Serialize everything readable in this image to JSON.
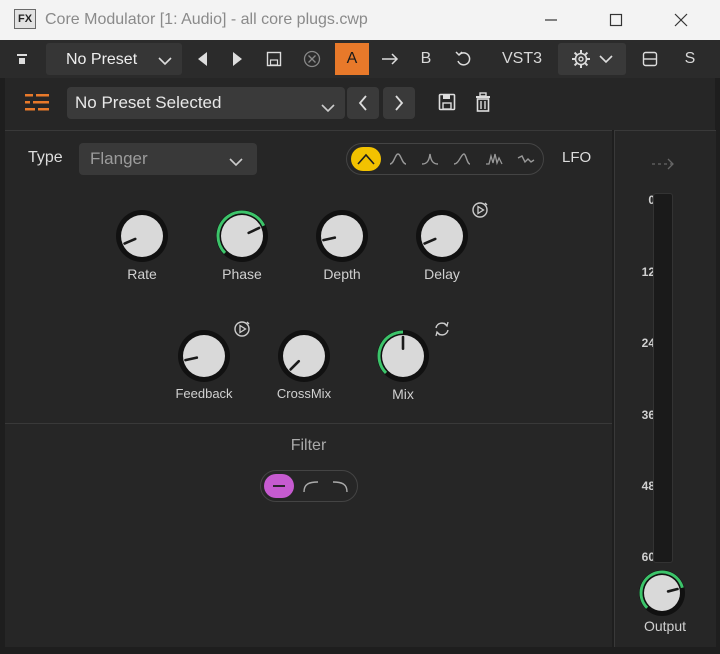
{
  "window": {
    "app_badge": "FX",
    "title": "Core Modulator [1: Audio] - all core plugs.cwp",
    "icons": [
      "minimize-icon",
      "maximize-icon",
      "close-icon"
    ]
  },
  "toolbar": {
    "preset_name": "No Preset",
    "ab_a": "A",
    "ab_b": "B",
    "format": "VST3",
    "s_label": "S",
    "accent": "#e8792a"
  },
  "preset_bar": {
    "selected": "No Preset Selected"
  },
  "controls": {
    "type_label": "Type",
    "type_value": "Flanger",
    "lfo_label": "LFO",
    "lfo_shapes": [
      "triangle",
      "sine-bump",
      "peak",
      "saw-up",
      "random-peaks",
      "noise"
    ],
    "lfo_selected": "triangle",
    "lfo_selected_color": "#f2c200",
    "knobs_row1": [
      {
        "label": "Rate",
        "value": 0.08,
        "active_ring": false
      },
      {
        "label": "Phase",
        "value": 0.74,
        "active_ring": true
      },
      {
        "label": "Depth",
        "value": 0.12,
        "active_ring": false
      },
      {
        "label": "Delay",
        "value": 0.08,
        "active_ring": false
      }
    ],
    "knobs_row2": [
      {
        "label": "Feedback",
        "value": 0.12,
        "active_ring": false
      },
      {
        "label": "CrossMix",
        "value": 0.0,
        "active_ring": false
      },
      {
        "label": "Mix",
        "value": 0.5,
        "active_ring": true
      }
    ],
    "ring_color": "#3cc46a",
    "filter_label": "Filter",
    "filter_options": [
      "off",
      "low-shelf",
      "high-shelf"
    ],
    "filter_selected": "off",
    "filter_selected_color": "#c65bd0"
  },
  "output": {
    "meter_ticks": [
      "0",
      "12",
      "24",
      "36",
      "48",
      "60"
    ],
    "knob_label": "Output",
    "knob_value": 0.78
  }
}
